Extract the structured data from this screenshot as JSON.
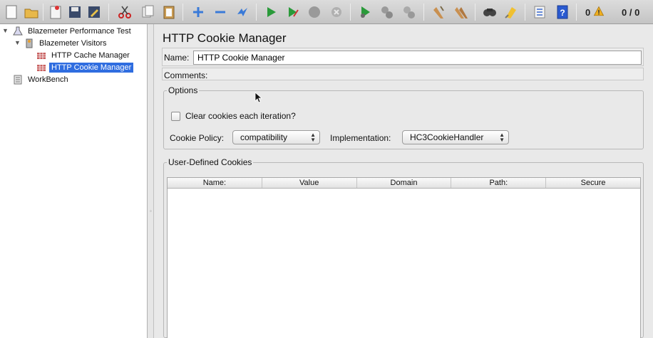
{
  "toolbar": {
    "error_count": "0",
    "thread_count": "0 / 0",
    "icons": [
      "new-icon",
      "open-icon",
      "templates-icon",
      "save-icon",
      "save-as-icon",
      "cut-icon",
      "copy-icon",
      "paste-icon",
      "expand-icon",
      "collapse-icon",
      "toggle-icon",
      "start-icon",
      "start-no-pause-icon",
      "stop-icon",
      "shutdown-icon",
      "remote-start-icon",
      "remote-stop-icon",
      "remote-shutdown-icon",
      "clear-icon",
      "clear-all-icon",
      "search-icon",
      "reset-search-icon",
      "function-helper-icon",
      "help-icon",
      "warning-icon"
    ]
  },
  "tree": {
    "items": [
      {
        "label": "Blazemeter Performance Test"
      },
      {
        "label": "Blazemeter Visitors"
      },
      {
        "label": "HTTP Cache Manager"
      },
      {
        "label": "HTTP Cookie Manager"
      },
      {
        "label": "WorkBench"
      }
    ]
  },
  "panel": {
    "title": "HTTP Cookie Manager",
    "name_label": "Name:",
    "name_value": "HTTP Cookie Manager",
    "comments_label": "Comments:",
    "options": {
      "legend": "Options",
      "clear_cookies_label": "Clear cookies each iteration?",
      "clear_cookies_checked": false,
      "cookie_policy_label": "Cookie Policy:",
      "cookie_policy_value": "compatibility",
      "implementation_label": "Implementation:",
      "implementation_value": "HC3CookieHandler"
    },
    "cookies": {
      "legend": "User-Defined Cookies",
      "columns": [
        "Name:",
        "Value",
        "Domain",
        "Path:",
        "Secure"
      ],
      "rows": []
    }
  },
  "colors": {
    "selection": "#2f6de0",
    "accent": "#2f6de0"
  }
}
